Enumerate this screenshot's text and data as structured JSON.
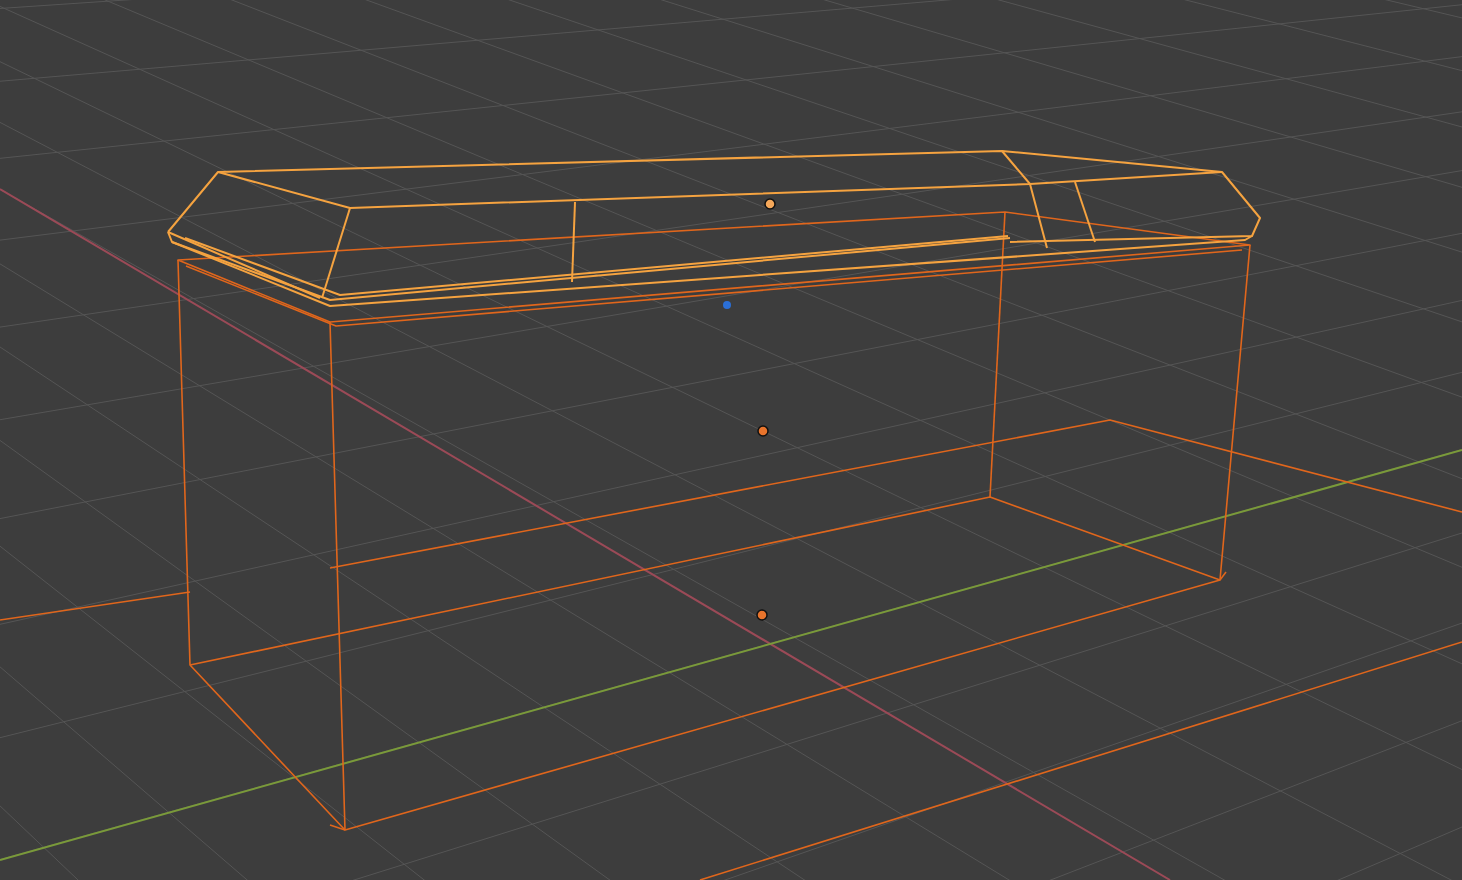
{
  "viewport": {
    "objects": [
      {
        "kind": "lid",
        "selected": true,
        "active": true
      },
      {
        "kind": "box",
        "selected": true,
        "active": false
      },
      {
        "kind": "plane",
        "selected": true,
        "active": false
      }
    ]
  }
}
